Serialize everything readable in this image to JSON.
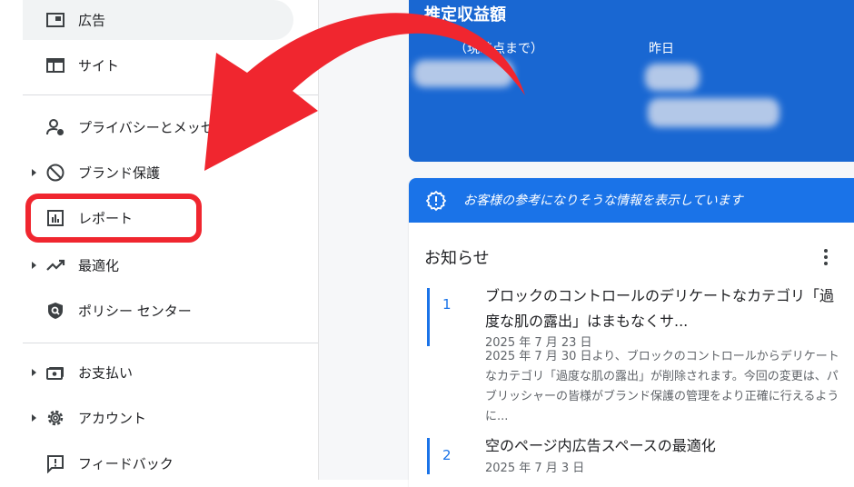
{
  "sidebar": {
    "items": [
      {
        "label": "広告",
        "icon": "ad-units-icon"
      },
      {
        "label": "サイト",
        "icon": "web-icon"
      },
      {
        "label": "プライバシーとメッセ",
        "icon": "manage-accounts-icon"
      },
      {
        "label": "ブランド保護",
        "icon": "block-icon"
      },
      {
        "label": "レポート",
        "icon": "bar-chart-icon"
      },
      {
        "label": "最適化",
        "icon": "trending-up-icon"
      },
      {
        "label": "ポリシー センター",
        "icon": "policy-icon"
      },
      {
        "label": "お支払い",
        "icon": "payments-icon"
      },
      {
        "label": "アカウント",
        "icon": "settings-icon"
      },
      {
        "label": "フィードバック",
        "icon": "feedback-icon"
      }
    ]
  },
  "earnings": {
    "title": "推定収益額",
    "label_today": "（現時点まで）",
    "label_yesterday": "昨日"
  },
  "notice_banner": {
    "text": "お客様の参考になりそうな情報を表示しています",
    "icon": "info-icon"
  },
  "news": {
    "title": "お知らせ",
    "items": [
      {
        "num": "1",
        "head": "ブロックのコントロールのデリケートなカテゴリ「過度な肌の露出」はまもなくサ...",
        "date": "2025 年 7 月 23 日",
        "body": "2025 年 7 月 30 日より、ブロックのコントロールからデリケートなカテゴリ「過度な肌の露出」が削除されます。今回の変更は、パブリッシャーの皆様がブランド保護の管理をより正確に行えるように..."
      },
      {
        "num": "2",
        "head": "空のページ内広告スペースの最適化",
        "date": "2025 年 7 月 3 日",
        "body": ""
      }
    ]
  },
  "colors": {
    "accent": "#1a73e8",
    "earnings_bg": "#1967d2",
    "annotation": "#f0262f"
  }
}
